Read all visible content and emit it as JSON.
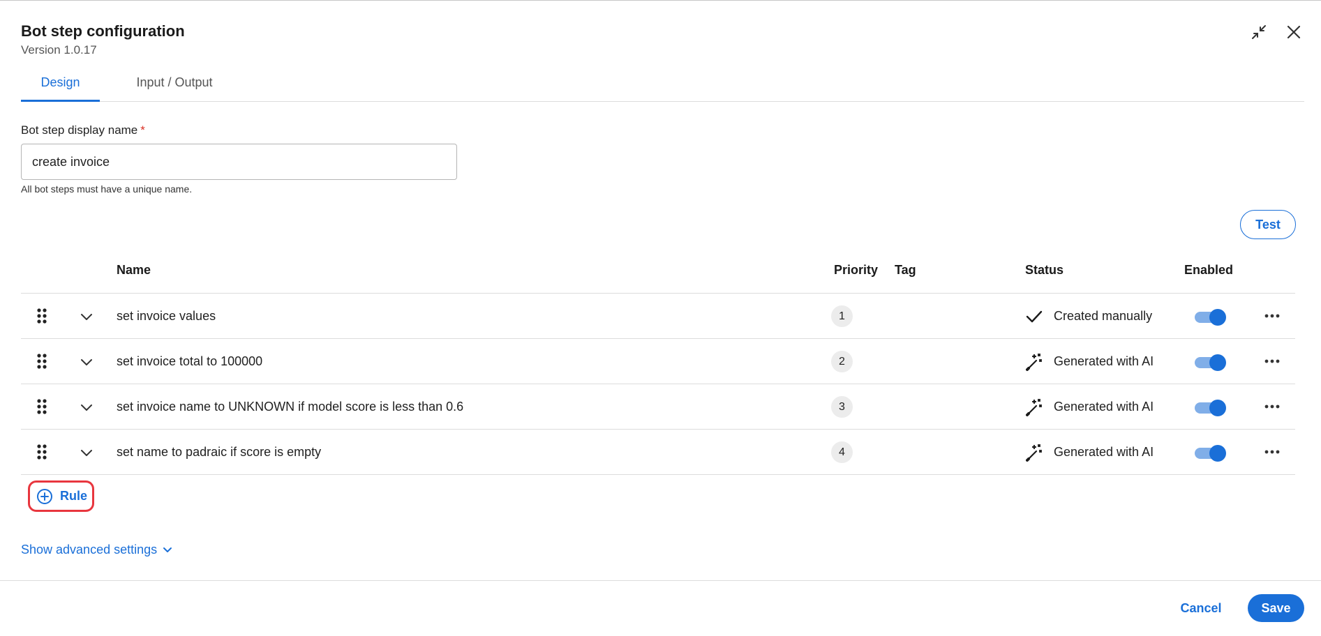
{
  "dialog": {
    "title": "Bot step configuration",
    "version": "Version 1.0.17",
    "collapse_icon": "collapse-arrows-icon",
    "close_icon": "close-icon"
  },
  "tabs": [
    {
      "label": "Design",
      "active": true
    },
    {
      "label": "Input / Output",
      "active": false
    }
  ],
  "form": {
    "display_name_label": "Bot step display name",
    "required_marker": "*",
    "display_name_value": "create invoice",
    "helper_text": "All bot steps must have a unique name."
  },
  "test_button": "Test",
  "table": {
    "headers": {
      "name": "Name",
      "priority": "Priority",
      "tag": "Tag",
      "status": "Status",
      "enabled": "Enabled"
    },
    "rows": [
      {
        "name": "set invoice values",
        "priority": "1",
        "tag": "",
        "status": "Created manually",
        "status_icon": "checkmark-icon",
        "enabled": true
      },
      {
        "name": "set invoice total to 100000",
        "priority": "2",
        "tag": "",
        "status": "Generated with AI",
        "status_icon": "magic-wand-icon",
        "enabled": true
      },
      {
        "name": "set invoice name to UNKNOWN if model score is less than 0.6",
        "priority": "3",
        "tag": "",
        "status": "Generated with AI",
        "status_icon": "magic-wand-icon",
        "enabled": true
      },
      {
        "name": "set name to padraic if score is empty",
        "priority": "4",
        "tag": "",
        "status": "Generated with AI",
        "status_icon": "magic-wand-icon",
        "enabled": true
      }
    ]
  },
  "add_rule_button": "Rule",
  "advanced_settings_link": "Show advanced settings",
  "footer": {
    "cancel": "Cancel",
    "save": "Save"
  },
  "colors": {
    "accent": "#1a6fd8",
    "highlight_outline": "#e8363e",
    "required": "#d93025"
  }
}
